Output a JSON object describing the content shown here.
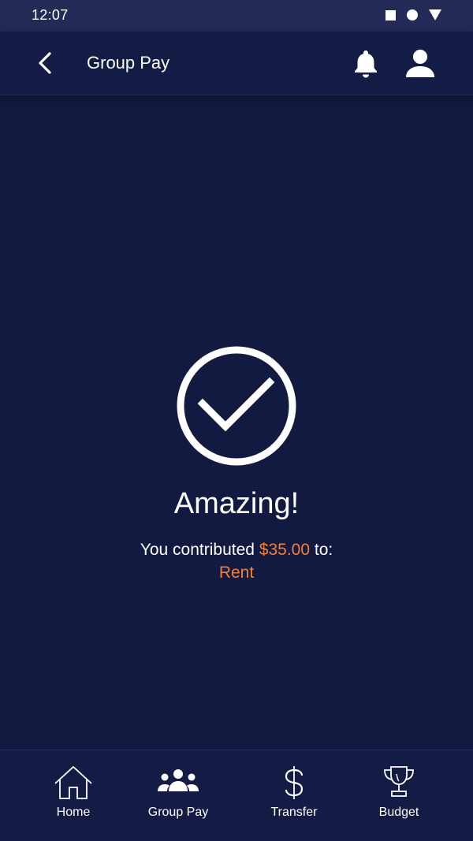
{
  "status_bar": {
    "time": "12:07"
  },
  "app_bar": {
    "title": "Group Pay"
  },
  "main": {
    "headline": "Amazing!",
    "message_prefix": "You contributed ",
    "amount": "$35.00",
    "message_suffix": " to:",
    "target": "Rent"
  },
  "bottom_nav": {
    "items": [
      {
        "label": "Home",
        "icon": "home-icon"
      },
      {
        "label": "Group Pay",
        "icon": "group-icon"
      },
      {
        "label": "Transfer",
        "icon": "dollar-icon"
      },
      {
        "label": "Budget",
        "icon": "trophy-icon"
      }
    ]
  },
  "colors": {
    "background": "#131a42",
    "status_bar": "#222a55",
    "accent": "#f0803c",
    "text": "#ffffff"
  }
}
